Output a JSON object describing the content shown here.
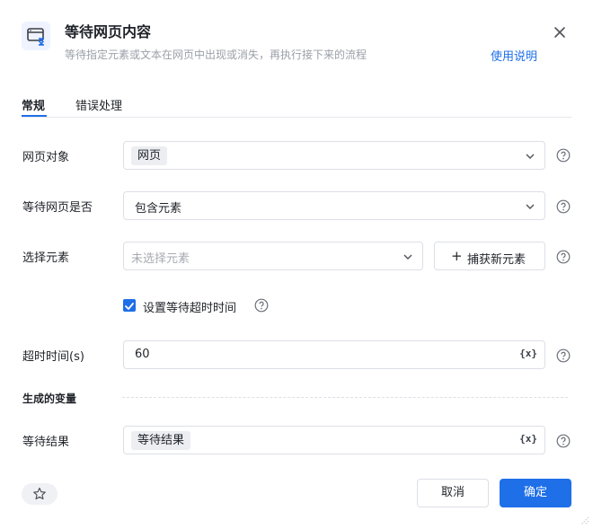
{
  "header": {
    "title": "等待网页内容",
    "subtitle": "等待指定元素或文本在网页中出现或消失，再执行接下来的流程",
    "help_link": "使用说明",
    "icon": "browser-wait-icon"
  },
  "tabs": [
    {
      "label": "常规",
      "active": true
    },
    {
      "label": "错误处理",
      "active": false
    }
  ],
  "form": {
    "web_object": {
      "label": "网页对象",
      "value": "网页"
    },
    "wait_mode": {
      "label": "等待网页是否",
      "value": "包含元素"
    },
    "select_element": {
      "label": "选择元素",
      "placeholder": "未选择元素",
      "capture_button": "捕获新元素"
    },
    "timeout_toggle": {
      "label": "设置等待超时时间",
      "checked": true
    },
    "timeout": {
      "label": "超时时间(s)",
      "value": "60",
      "var_icon": "{x}"
    }
  },
  "variables": {
    "section_title": "生成的变量",
    "wait_result": {
      "label": "等待结果",
      "value": "等待结果",
      "var_icon": "{x}"
    }
  },
  "footer": {
    "cancel": "取消",
    "confirm": "确定"
  },
  "colors": {
    "accent": "#1e6fe8",
    "border": "#dcdfe6",
    "muted": "#9aa0a8"
  }
}
